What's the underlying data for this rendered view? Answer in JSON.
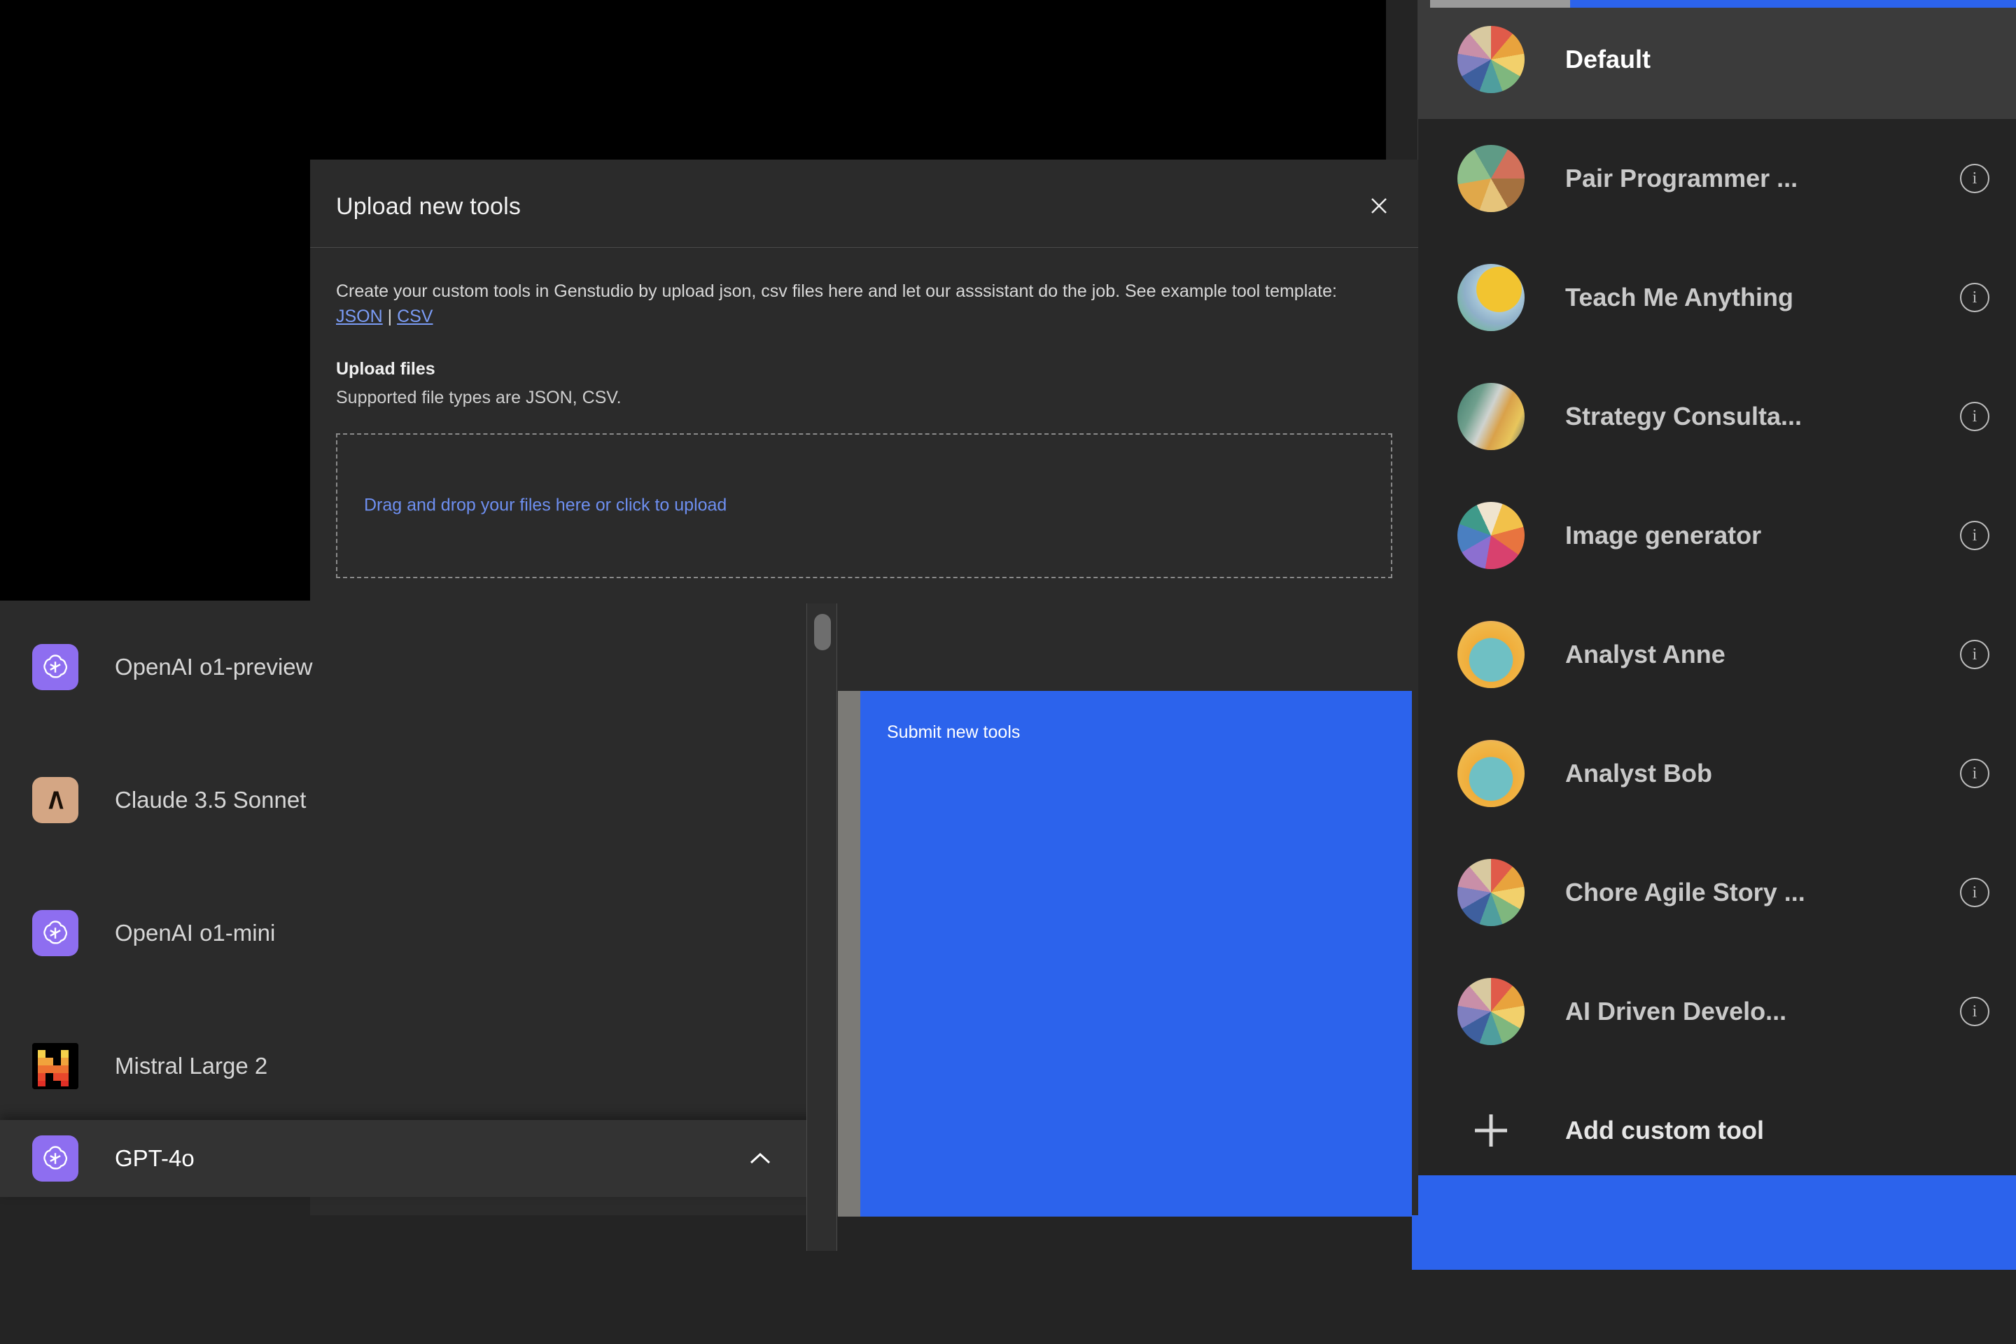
{
  "dialog": {
    "title": "Upload new tools",
    "close_icon": "close-icon",
    "intro_before": "Create your custom tools in Genstudio by upload json, csv files here and let our asssistant do the job. See example tool template: ",
    "link_json": "JSON",
    "link_separator": " | ",
    "link_csv": "CSV",
    "upload_files_label": "Upload files",
    "supported_types": "Supported file types are JSON, CSV.",
    "dropzone_text": "Drag and drop your files here or click to upload",
    "submit_label": "Submit new tools"
  },
  "model_selector": {
    "selected": {
      "name": "GPT-4o",
      "icon": "openai-logo-icon"
    },
    "chevron": "chevron-up-icon",
    "options": [
      {
        "name": "OpenAI o1-preview",
        "icon": "openai-logo-icon",
        "brand": "openai"
      },
      {
        "name": "Claude 3.5 Sonnet",
        "icon": "anthropic-logo-icon",
        "brand": "claude"
      },
      {
        "name": "OpenAI o1-mini",
        "icon": "openai-logo-icon",
        "brand": "openai"
      },
      {
        "name": "Mistral Large 2",
        "icon": "mistral-logo-icon",
        "brand": "mistral"
      }
    ]
  },
  "tools_sidebar": {
    "add_custom_tool": "Add custom tool",
    "add_icon": "plus-icon",
    "info_icon_glyph": "i",
    "items": [
      {
        "label": "Default",
        "selected": true,
        "has_info": false,
        "avatar": "flower-rosette-avatar"
      },
      {
        "label": "Pair Programmer ...",
        "selected": false,
        "has_info": true,
        "avatar": "desk-feathers-avatar"
      },
      {
        "label": "Teach Me Anything",
        "selected": false,
        "has_info": true,
        "avatar": "lion-face-avatar"
      },
      {
        "label": "Strategy Consulta...",
        "selected": false,
        "has_info": true,
        "avatar": "figure-leaves-avatar"
      },
      {
        "label": "Image generator",
        "selected": false,
        "has_info": true,
        "avatar": "feather-fan-avatar"
      },
      {
        "label": "Analyst Anne",
        "selected": false,
        "has_info": true,
        "avatar": "elephant-avatar"
      },
      {
        "label": "Analyst Bob",
        "selected": false,
        "has_info": true,
        "avatar": "elephant-avatar"
      },
      {
        "label": "Chore Agile Story ...",
        "selected": false,
        "has_info": true,
        "avatar": "flower-rosette-avatar"
      },
      {
        "label": "AI Driven Develo...",
        "selected": false,
        "has_info": true,
        "avatar": "flower-rosette-avatar"
      }
    ]
  },
  "colors": {
    "accent_blue": "#2c63ec",
    "link_blue": "#6e8ff0",
    "dialog_bg": "#2b2b2b",
    "page_bg": "#242424",
    "selected_row": "#3b3b3b"
  }
}
